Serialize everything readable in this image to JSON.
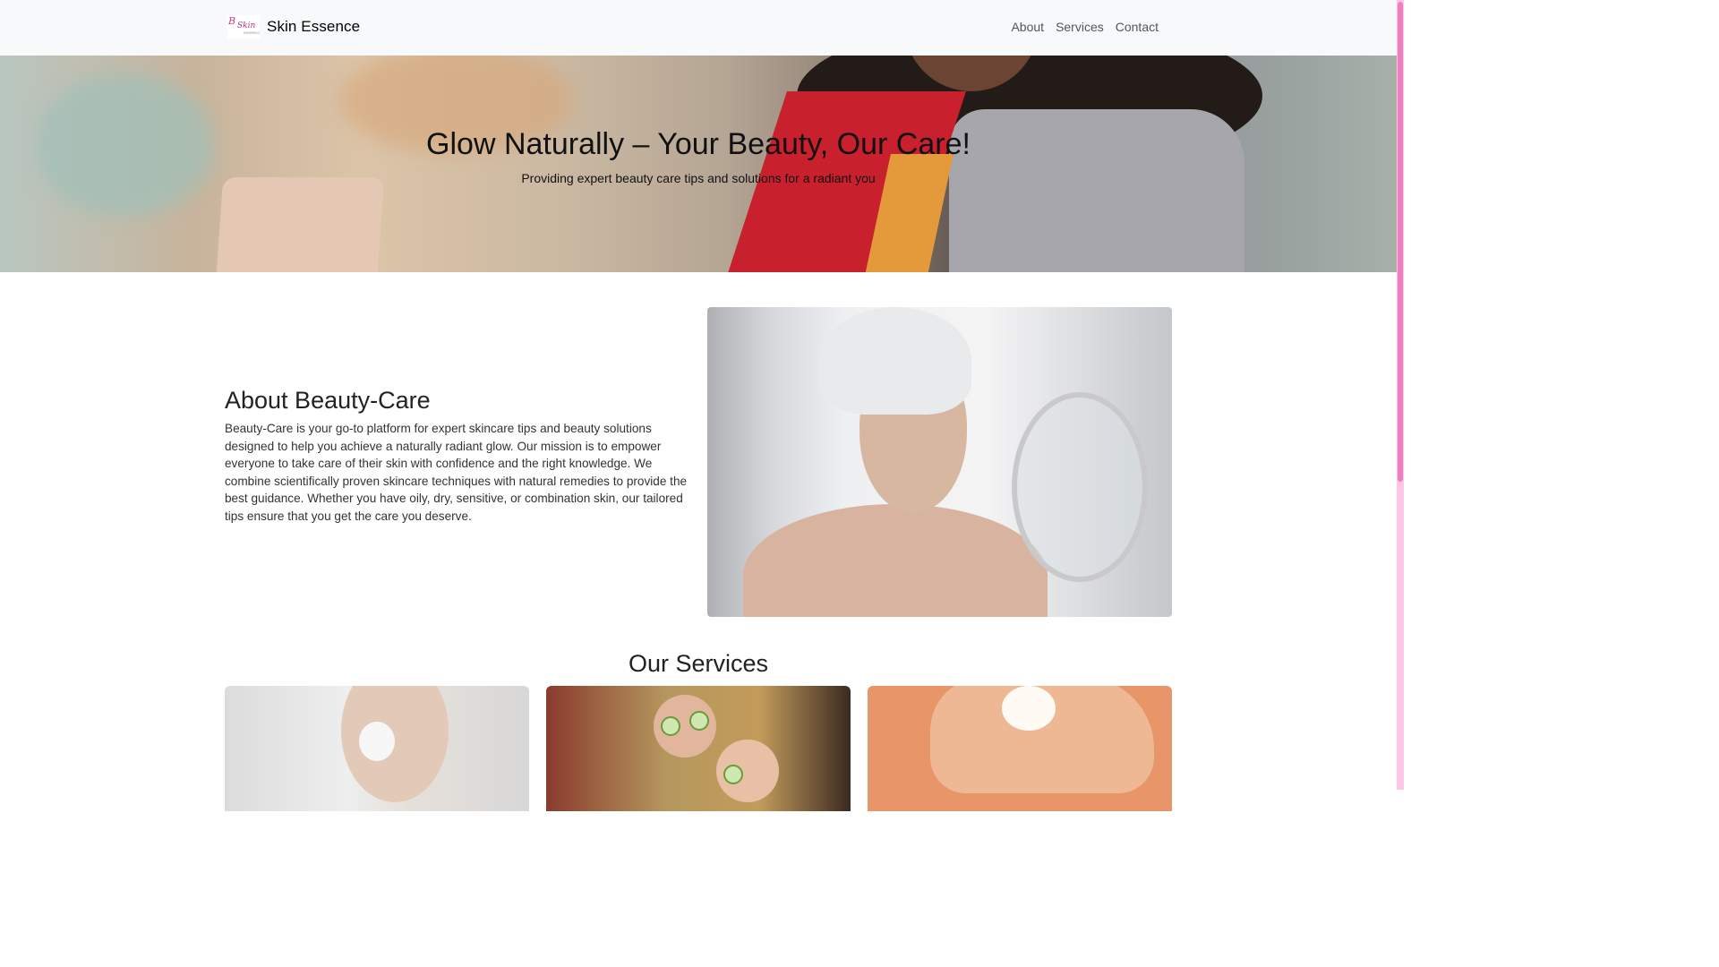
{
  "navbar": {
    "brand_name": "Skin Essence",
    "links": [
      "About",
      "Services",
      "Contact"
    ]
  },
  "hero": {
    "title": "Glow Naturally – Your Beauty, Our Care!",
    "subtitle": "Providing expert beauty care tips and solutions for a radiant you"
  },
  "about": {
    "title": "About Beauty-Care",
    "text": "Beauty-Care is your go-to platform for expert skincare tips and beauty solutions designed to help you achieve a naturally radiant glow. Our mission is to empower everyone to take care of their skin with confidence and the right knowledge. We combine scientifically proven skincare techniques with natural remedies to provide the best guidance. Whether you have oily, dry, sensitive, or combination skin, our tailored tips ensure that you get the care you deserve."
  },
  "services": {
    "title": "Our Services"
  },
  "colors": {
    "navbar_bg": "#f8f9fa",
    "scrollbar_track": "#ffc6e5",
    "scrollbar_thumb": "#f07fc0"
  }
}
